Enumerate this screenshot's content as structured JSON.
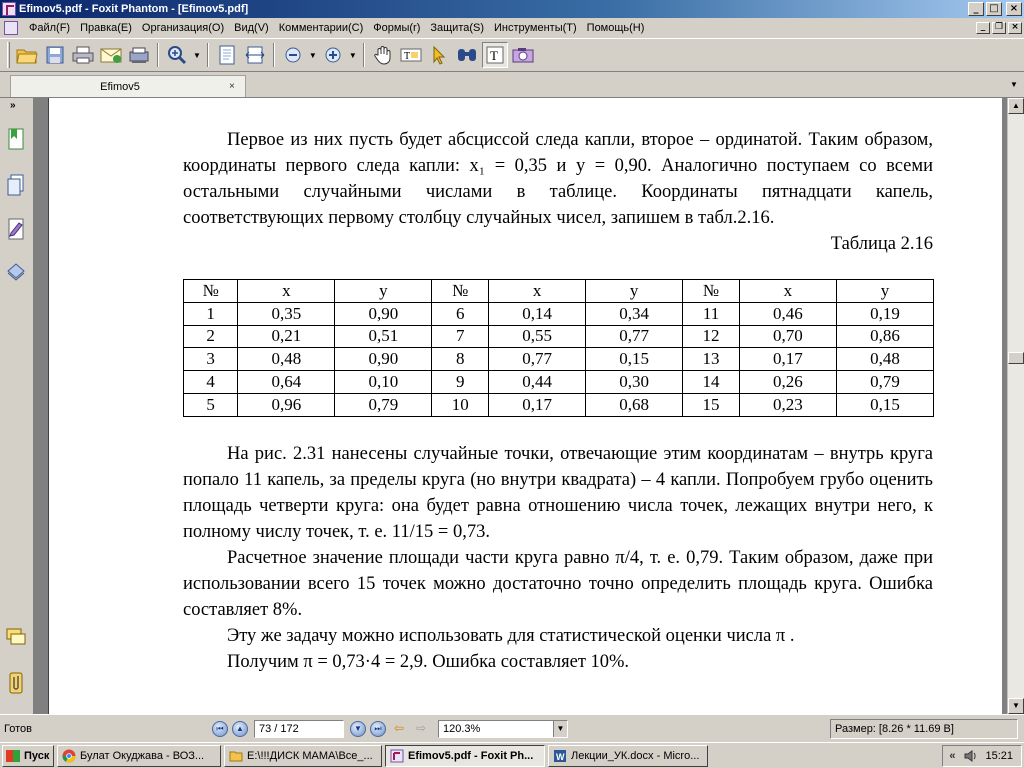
{
  "window": {
    "title": "Efimov5.pdf - Foxit Phantom - [Efimov5.pdf]"
  },
  "menu": [
    "Файл(F)",
    "Правка(E)",
    "Организация(O)",
    "Вид(V)",
    "Комментарии(C)",
    "Формы(r)",
    "Защита(S)",
    "Инструменты(T)",
    "Помощь(H)"
  ],
  "toolbar": {
    "icons": [
      "open-folder",
      "save",
      "print",
      "email",
      "scan",
      "zoom-in",
      "fit-page",
      "fit-width",
      "zoom-out-minus",
      "zoom-in-plus",
      "hand",
      "select-text",
      "select-arrow",
      "find",
      "typewriter",
      "snapshot"
    ]
  },
  "tab": {
    "label": "Efimov5",
    "close": "×"
  },
  "document": {
    "paragraph1": "Первое из них пусть будет абсциссой следа капли, второе – ординатой. Таким образом, координаты первого  следа капли: x₁ = 0,35 и y = 0,90. Аналогично поступаем со всеми остальными случайными  числами в таблице. Координаты пятнадцати капель, соответствующих первому столбцу случайных чисел, запишем в табл.2.16.",
    "table_caption": "Таблица 2.16",
    "table": {
      "headers": [
        "№",
        "x",
        "y",
        "№",
        "x",
        "y",
        "№",
        "x",
        "y"
      ],
      "rows": [
        [
          "1",
          "0,35",
          "0,90",
          "6",
          "0,14",
          "0,34",
          "11",
          "0,46",
          "0,19"
        ],
        [
          "2",
          "0,21",
          "0,51",
          "7",
          "0,55",
          "0,77",
          "12",
          "0,70",
          "0,86"
        ],
        [
          "3",
          "0,48",
          "0,90",
          "8",
          "0,77",
          "0,15",
          "13",
          "0,17",
          "0,48"
        ],
        [
          "4",
          "0,64",
          "0,10",
          "9",
          "0,44",
          "0,30",
          "14",
          "0,26",
          "0,79"
        ],
        [
          "5",
          "0,96",
          "0,79",
          "10",
          "0,17",
          "0,68",
          "15",
          "0,23",
          "0,15"
        ]
      ]
    },
    "paragraph2": "На рис. 2.31 нанесены случайные точки, отвечающие этим координатам – внутрь круга попало 11 капель, за пределы круга (но внутри квадрата) – 4 капли. Попробуем грубо оценить  площадь четверти круга: она будет равна отношению числа точек, лежащих внутри него,  к полному числу точек, т. е. 11/15 = 0,73.",
    "paragraph3": "Расчетное значение площади части круга равно π/4, т. е. 0,79. Таким образом, даже при использовании всего 15 точек  можно достаточно точно определить площадь круга. Ошибка составляет  8%.",
    "paragraph4": "Эту же задачу можно использовать для статистической оценки числа  π .",
    "paragraph5": "Получим π = 0,73·4 = 2,9. Ошибка составляет 10%."
  },
  "status": {
    "ready": "Готов",
    "page": "73 / 172",
    "zoom": "120.3%",
    "size": "Размер: [8.26 * 11.69 B]"
  },
  "taskbar": {
    "start": "Пуск",
    "tasks": [
      {
        "label": "Булат Окуджава - ВОЗ...",
        "icon": "chrome"
      },
      {
        "label": "E:\\!!!ДИСК МАМА\\Все_...",
        "icon": "folder"
      },
      {
        "label": "Efimov5.pdf - Foxit Ph...",
        "icon": "foxit",
        "active": true
      },
      {
        "label": "Лекции_УК.docx - Micro...",
        "icon": "word"
      }
    ],
    "clock": "15:21",
    "tray_icons": [
      "chevron-left",
      "speaker"
    ]
  },
  "colors": {
    "title_gradient_start": "#0a246a",
    "chrome": "#d4d0c8",
    "doc_background": "#808080",
    "page": "#ffffff"
  }
}
